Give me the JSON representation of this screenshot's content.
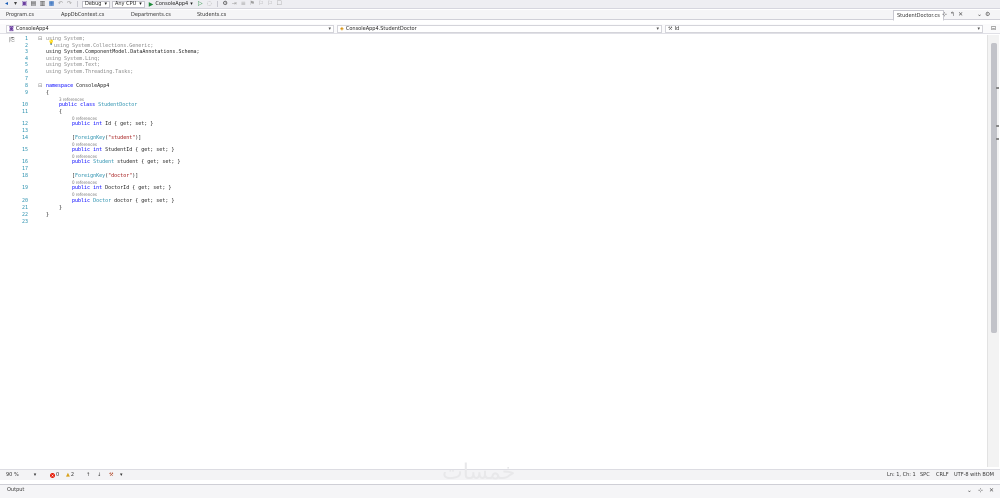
{
  "toolbar": {
    "config": "Debug",
    "platform": "Any CPU",
    "run_target": "ConsoleApp4"
  },
  "tabs": [
    {
      "label": "Program.cs"
    },
    {
      "label": "AppDbContext.cs"
    },
    {
      "label": "Departments.cs"
    },
    {
      "label": "Students.cs"
    },
    {
      "label": "StudentDoctor.cs"
    }
  ],
  "navbar": {
    "project": "ConsoleApp4",
    "type": "ConsoleApp4.StudentDoctor",
    "member": "Id"
  },
  "code": {
    "l1": "using System;",
    "l2": "using System.Collections.Generic;",
    "l3": "using System.ComponentModel.DataAnnotations.Schema;",
    "l4": "using System.Linq;",
    "l5": "using System.Text;",
    "l6": "using System.Threading.Tasks;",
    "l8_kw": "namespace",
    "l8_name": " ConsoleApp4",
    "l9": "{",
    "refs_class": "3 references",
    "l10_kw": "public class",
    "l10_name": " StudentDoctor",
    "l11": "{",
    "refs_12": "0 references",
    "l12_kw": "public int",
    "l12_rest": " Id { get; set; }",
    "l14_attr": "ForeignKey",
    "l14_str": "\"student\"",
    "refs_15": "0 references",
    "l15_kw": "public int",
    "l15_rest": " StudentId { get; set; }",
    "refs_16": "0 references",
    "l16_kw": "public",
    "l16_type": " Student",
    "l16_rest": " student { get; set; }",
    "l18_attr": "ForeignKey",
    "l18_str": "\"doctor\"",
    "refs_19": "0 references",
    "l19_kw": "public int",
    "l19_rest": " DoctorId { get; set; }",
    "refs_20": "0 references",
    "l20_kw": "public",
    "l20_type": " Doctor",
    "l20_rest": " doctor { get; set; }",
    "l21": "}",
    "l22": "}"
  },
  "line_numbers": [
    "1",
    "2",
    "3",
    "4",
    "5",
    "6",
    "7",
    "8",
    "9",
    "10",
    "11",
    "12",
    "13",
    "14",
    "15",
    "16",
    "17",
    "18",
    "19",
    "20",
    "21",
    "22",
    "23"
  ],
  "status": {
    "zoom": "90 %",
    "errors": "0",
    "warnings": "2",
    "position": "Ln: 1, Ch: 1",
    "whitespace": "SPC",
    "line_endings": "CRLF",
    "encoding": "UTF-8 with BOM"
  },
  "watermark": "خمسات",
  "output": {
    "title": "Output"
  },
  "colors": {
    "keyword": "#0000ff",
    "type": "#2b91af",
    "string": "#a31515",
    "line_number": "#2b91af"
  }
}
